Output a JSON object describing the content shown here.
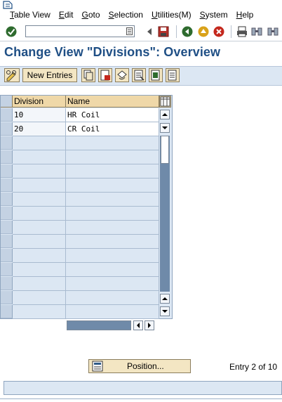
{
  "menu": {
    "items": [
      {
        "label": "Table View",
        "u": "T",
        "rest": "able View"
      },
      {
        "label": "Edit",
        "u": "E",
        "rest": "dit"
      },
      {
        "label": "Goto",
        "u": "G",
        "rest": "oto"
      },
      {
        "label": "Selection",
        "u": "S",
        "rest": "election"
      },
      {
        "label": "Utilities(M)",
        "u": "U",
        "rest": "tilities(M)"
      },
      {
        "label": "System",
        "u": "S",
        "rest": "ystem"
      },
      {
        "label": "Help",
        "u": "H",
        "rest": "elp"
      }
    ]
  },
  "command_field": {
    "value": ""
  },
  "title": "Change View \"Divisions\": Overview",
  "app_toolbar": {
    "new_entries_label": "New Entries"
  },
  "table": {
    "headers": [
      "Division",
      "Name"
    ],
    "rows": [
      {
        "division": "10",
        "name": "HR Coil"
      },
      {
        "division": "20",
        "name": "CR Coil"
      },
      {
        "division": "",
        "name": ""
      },
      {
        "division": "",
        "name": ""
      },
      {
        "division": "",
        "name": ""
      },
      {
        "division": "",
        "name": ""
      },
      {
        "division": "",
        "name": ""
      },
      {
        "division": "",
        "name": ""
      },
      {
        "division": "",
        "name": ""
      },
      {
        "division": "",
        "name": ""
      },
      {
        "division": "",
        "name": ""
      },
      {
        "division": "",
        "name": ""
      },
      {
        "division": "",
        "name": ""
      },
      {
        "division": "",
        "name": ""
      },
      {
        "division": "",
        "name": ""
      }
    ]
  },
  "footer": {
    "position_label": "Position...",
    "entry_info": "Entry 2 of 10"
  },
  "colors": {
    "title": "#1f4f85",
    "toolbar_bg": "#dce7f3",
    "button_bg": "#f3e6c3",
    "header_bg": "#efd8a8"
  }
}
